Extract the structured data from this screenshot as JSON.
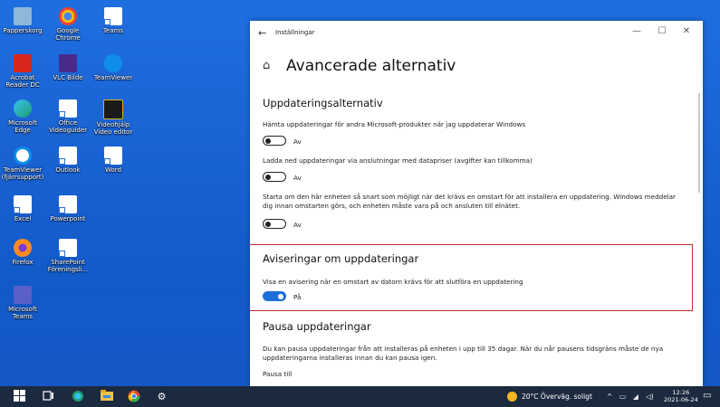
{
  "desktop": {
    "icons": [
      {
        "label": "Papperskorg",
        "color": "#8fb7d8"
      },
      {
        "label": "Google Chrome",
        "color": "#e84a3a"
      },
      {
        "label": "Teams",
        "color": "#5b5fc7"
      },
      {
        "label": "Acrobat Reader DC",
        "color": "#d9261c"
      },
      {
        "label": "VLC Bilde",
        "color": "#4a2a8a"
      },
      {
        "label": "TeamViewer",
        "color": "#0e8ee9"
      },
      {
        "label": "Microsoft Edge",
        "color": "#1f9e6e"
      },
      {
        "label": "Office Videoguider",
        "color": "#ffffff"
      },
      {
        "label": "Videohjälp Video editor",
        "color": "#e0b21c"
      },
      {
        "label": "TeamViewer (fjärrsupport)",
        "color": "#0e8ee9"
      },
      {
        "label": "Outlook",
        "color": "#ffffff"
      },
      {
        "label": "Word",
        "color": "#ffffff"
      },
      {
        "label": "Excel",
        "color": "#ffffff"
      },
      {
        "label": "Powerpoint",
        "color": "#ffffff"
      },
      {
        "label": "Firefox",
        "color": "#ff8a1f"
      },
      {
        "label": "SharePoint Föreningsli...",
        "color": "#ffffff"
      },
      {
        "label": "Microsoft Teams",
        "color": "#5b5fc7"
      }
    ]
  },
  "window": {
    "app_title": "Inställningar",
    "back_icon": "back-arrow-icon",
    "controls": {
      "minimize": "—",
      "maximize": "☐",
      "close": "✕"
    },
    "home_icon": "home-icon",
    "page_title": "Avancerade alternativ",
    "sections": {
      "update_options_title": "Uppdateringsalternativ",
      "opt1_text": "Hämta uppdateringar för andra Microsoft-produkter när jag uppdaterar Windows",
      "opt1_state": "Av",
      "opt2_text": "Ladda ned uppdateringar via anslutningar med datapriser (avgifter kan tillkomma)",
      "opt2_state": "Av",
      "opt3_text": "Starta om den här enheten så snart som möjligt när det krävs en omstart för att installera en uppdatering. Windows meddelar dig innan omstarten görs, och enheten måste vara på och ansluten till elnätet.",
      "opt3_state": "Av",
      "notify_title": "Aviseringar om uppdateringar",
      "notify_text": "Visa en avisering när en omstart av datorn krävs för att slutföra en uppdatering",
      "notify_state": "På",
      "pause_title": "Pausa uppdateringar",
      "pause_text": "Du kan pausa uppdateringar från att installeras på enheten i upp till 35 dagar. När du når pausens tidsgräns måste de nya uppdateringarna installeras innan du kan pausa igen.",
      "pause_until_label": "Pausa till"
    },
    "highlight_color": "#c42b2b",
    "toggle_on_color": "#1d6fd8"
  },
  "taskbar": {
    "weather": "20°C  Överväg. soligt",
    "time": "12:26",
    "date": "2021-06-24",
    "tray_chevron": "^"
  }
}
